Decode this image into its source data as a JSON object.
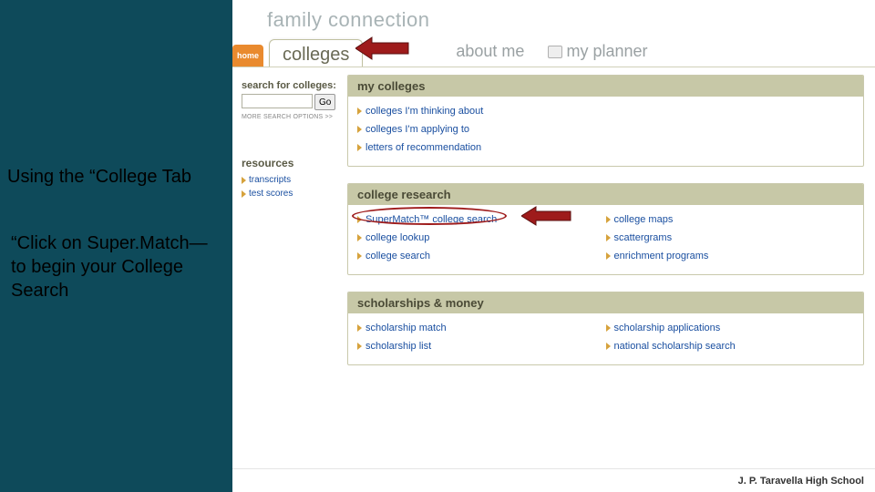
{
  "brand": "family connection",
  "tabs": {
    "home": "home",
    "colleges": "colleges",
    "about_me": "about me",
    "my_planner": "my planner"
  },
  "sidebar": {
    "search_label": "search for colleges:",
    "go": "Go",
    "more_opts": "MORE SEARCH OPTIONS >>",
    "resources_head": "resources",
    "links": [
      "transcripts",
      "test scores"
    ]
  },
  "panels": {
    "my_colleges": {
      "title": "my colleges",
      "links": [
        "colleges I'm thinking about",
        "colleges I'm applying to",
        "letters of recommendation"
      ]
    },
    "research": {
      "title": "college research",
      "left": [
        "SuperMatch™ college search",
        "college lookup",
        "college search"
      ],
      "right": [
        "college maps",
        "scattergrams",
        "enrichment programs"
      ]
    },
    "scholarships": {
      "title": "scholarships & money",
      "left": [
        "scholarship match",
        "scholarship list"
      ],
      "right": [
        "scholarship applications",
        "national scholarship search"
      ]
    }
  },
  "footer": "J. P. Taravella High School",
  "instructions": {
    "line1": "Using the “College Tab",
    "line2": "“Click on Super.Match—\nto begin your College\nSearch"
  }
}
